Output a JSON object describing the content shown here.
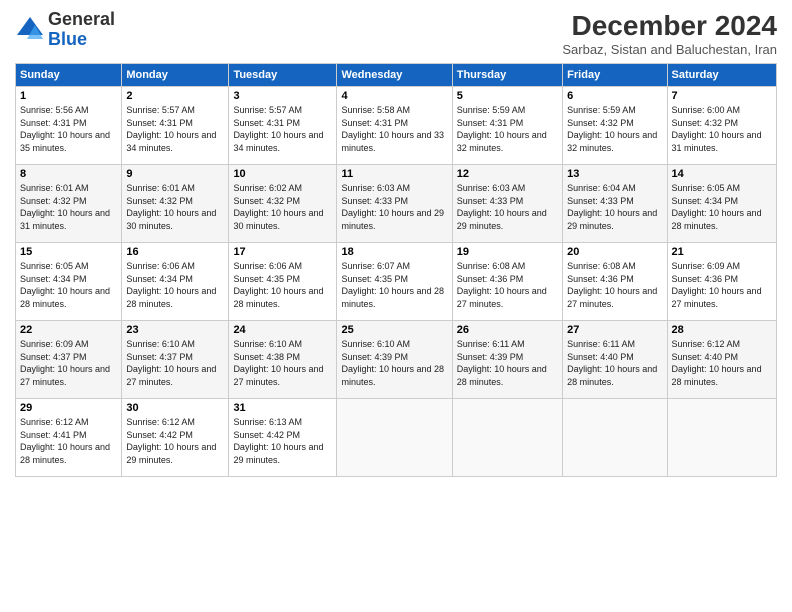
{
  "header": {
    "logo_line1": "General",
    "logo_line2": "Blue",
    "title": "December 2024",
    "subtitle": "Sarbaz, Sistan and Baluchestan, Iran"
  },
  "days_of_week": [
    "Sunday",
    "Monday",
    "Tuesday",
    "Wednesday",
    "Thursday",
    "Friday",
    "Saturday"
  ],
  "weeks": [
    [
      {
        "num": "1",
        "rise": "5:56 AM",
        "set": "4:31 PM",
        "daylight": "10 hours and 35 minutes."
      },
      {
        "num": "2",
        "rise": "5:57 AM",
        "set": "4:31 PM",
        "daylight": "10 hours and 34 minutes."
      },
      {
        "num": "3",
        "rise": "5:57 AM",
        "set": "4:31 PM",
        "daylight": "10 hours and 34 minutes."
      },
      {
        "num": "4",
        "rise": "5:58 AM",
        "set": "4:31 PM",
        "daylight": "10 hours and 33 minutes."
      },
      {
        "num": "5",
        "rise": "5:59 AM",
        "set": "4:31 PM",
        "daylight": "10 hours and 32 minutes."
      },
      {
        "num": "6",
        "rise": "5:59 AM",
        "set": "4:32 PM",
        "daylight": "10 hours and 32 minutes."
      },
      {
        "num": "7",
        "rise": "6:00 AM",
        "set": "4:32 PM",
        "daylight": "10 hours and 31 minutes."
      }
    ],
    [
      {
        "num": "8",
        "rise": "6:01 AM",
        "set": "4:32 PM",
        "daylight": "10 hours and 31 minutes."
      },
      {
        "num": "9",
        "rise": "6:01 AM",
        "set": "4:32 PM",
        "daylight": "10 hours and 30 minutes."
      },
      {
        "num": "10",
        "rise": "6:02 AM",
        "set": "4:32 PM",
        "daylight": "10 hours and 30 minutes."
      },
      {
        "num": "11",
        "rise": "6:03 AM",
        "set": "4:33 PM",
        "daylight": "10 hours and 29 minutes."
      },
      {
        "num": "12",
        "rise": "6:03 AM",
        "set": "4:33 PM",
        "daylight": "10 hours and 29 minutes."
      },
      {
        "num": "13",
        "rise": "6:04 AM",
        "set": "4:33 PM",
        "daylight": "10 hours and 29 minutes."
      },
      {
        "num": "14",
        "rise": "6:05 AM",
        "set": "4:34 PM",
        "daylight": "10 hours and 28 minutes."
      }
    ],
    [
      {
        "num": "15",
        "rise": "6:05 AM",
        "set": "4:34 PM",
        "daylight": "10 hours and 28 minutes."
      },
      {
        "num": "16",
        "rise": "6:06 AM",
        "set": "4:34 PM",
        "daylight": "10 hours and 28 minutes."
      },
      {
        "num": "17",
        "rise": "6:06 AM",
        "set": "4:35 PM",
        "daylight": "10 hours and 28 minutes."
      },
      {
        "num": "18",
        "rise": "6:07 AM",
        "set": "4:35 PM",
        "daylight": "10 hours and 28 minutes."
      },
      {
        "num": "19",
        "rise": "6:08 AM",
        "set": "4:36 PM",
        "daylight": "10 hours and 27 minutes."
      },
      {
        "num": "20",
        "rise": "6:08 AM",
        "set": "4:36 PM",
        "daylight": "10 hours and 27 minutes."
      },
      {
        "num": "21",
        "rise": "6:09 AM",
        "set": "4:36 PM",
        "daylight": "10 hours and 27 minutes."
      }
    ],
    [
      {
        "num": "22",
        "rise": "6:09 AM",
        "set": "4:37 PM",
        "daylight": "10 hours and 27 minutes."
      },
      {
        "num": "23",
        "rise": "6:10 AM",
        "set": "4:37 PM",
        "daylight": "10 hours and 27 minutes."
      },
      {
        "num": "24",
        "rise": "6:10 AM",
        "set": "4:38 PM",
        "daylight": "10 hours and 27 minutes."
      },
      {
        "num": "25",
        "rise": "6:10 AM",
        "set": "4:39 PM",
        "daylight": "10 hours and 28 minutes."
      },
      {
        "num": "26",
        "rise": "6:11 AM",
        "set": "4:39 PM",
        "daylight": "10 hours and 28 minutes."
      },
      {
        "num": "27",
        "rise": "6:11 AM",
        "set": "4:40 PM",
        "daylight": "10 hours and 28 minutes."
      },
      {
        "num": "28",
        "rise": "6:12 AM",
        "set": "4:40 PM",
        "daylight": "10 hours and 28 minutes."
      }
    ],
    [
      {
        "num": "29",
        "rise": "6:12 AM",
        "set": "4:41 PM",
        "daylight": "10 hours and 28 minutes."
      },
      {
        "num": "30",
        "rise": "6:12 AM",
        "set": "4:42 PM",
        "daylight": "10 hours and 29 minutes."
      },
      {
        "num": "31",
        "rise": "6:13 AM",
        "set": "4:42 PM",
        "daylight": "10 hours and 29 minutes."
      },
      null,
      null,
      null,
      null
    ]
  ]
}
